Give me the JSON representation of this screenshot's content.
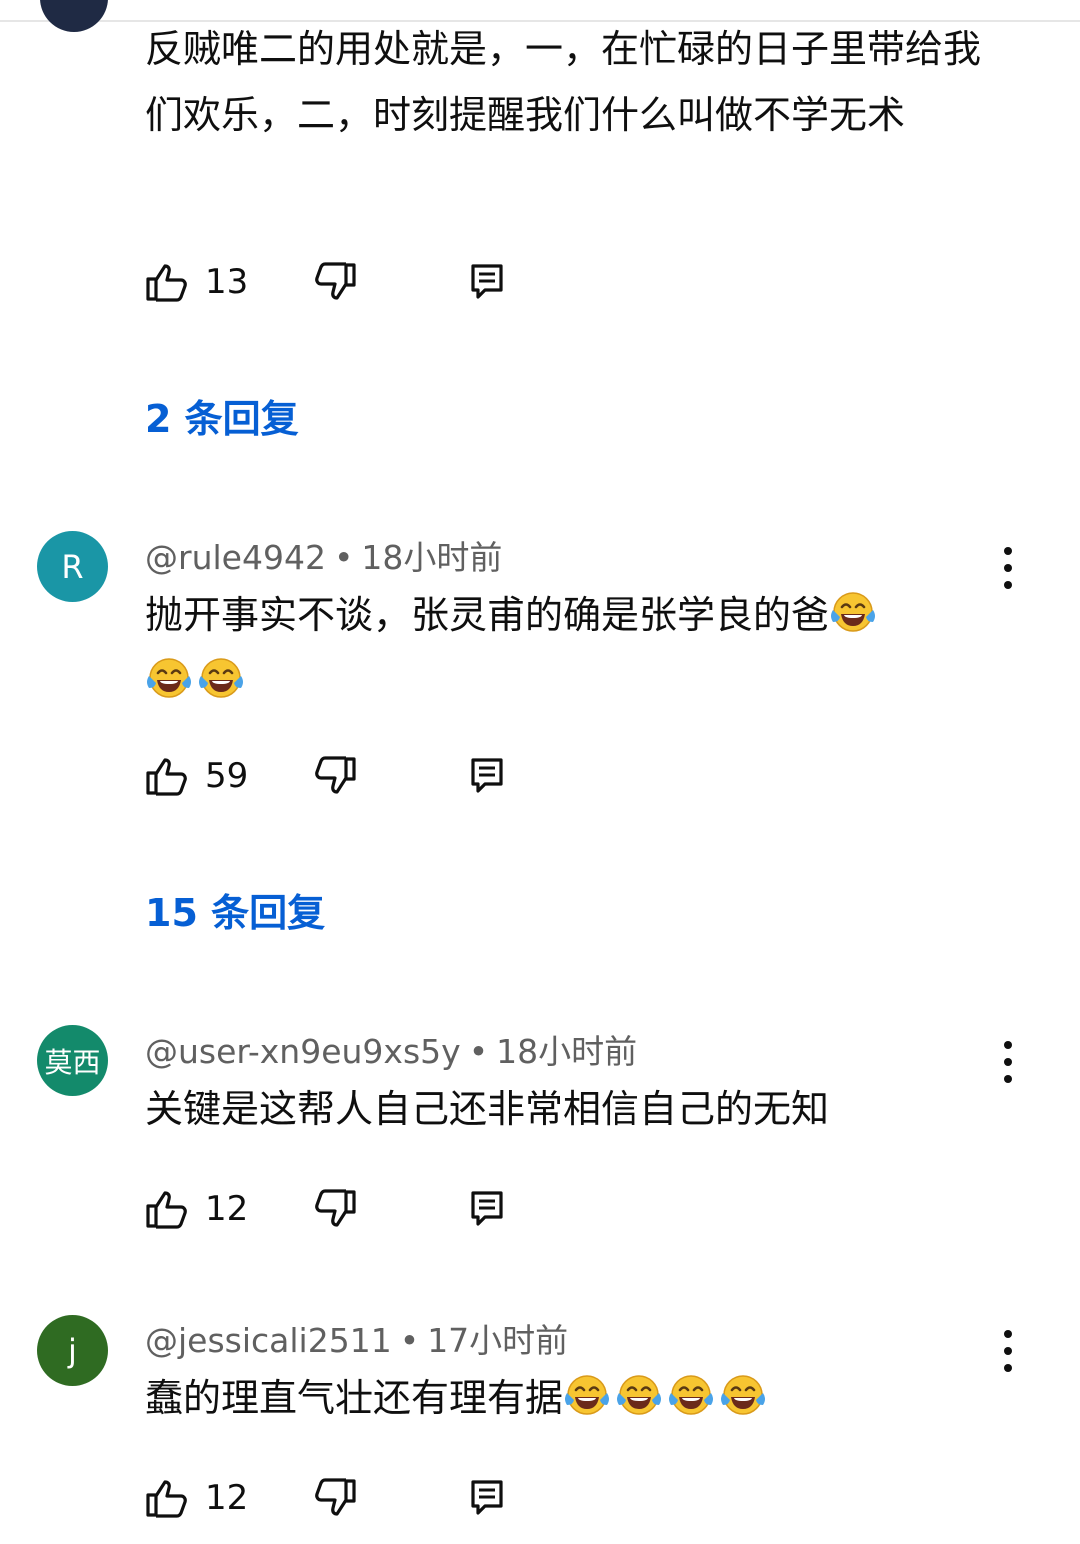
{
  "comments": [
    {
      "author": "",
      "time": "",
      "text": "反贼唯二的用处就是，一，在忙碌的日子里带给我们欢乐，二，时刻提醒我们什么叫做不学无术",
      "likes": "13",
      "replies": "2 条回复"
    },
    {
      "avatar_letter": "R",
      "avatar_color": "#1a96a6",
      "author": "@rule4942",
      "time": "18小时前",
      "text": "抛开事实不谈，张灵甫的确是张学良的爸",
      "emoji": "face-with-tears-of-joy",
      "emoji_count": 3,
      "likes": "59",
      "replies": "15 条回复"
    },
    {
      "avatar_letter": "莫西",
      "avatar_color": "#138a6b",
      "author": "@user-xn9eu9xs5y",
      "time": "18小时前",
      "text": "关键是这帮人自己还非常相信自己的无知",
      "likes": "12"
    },
    {
      "avatar_letter": "j",
      "avatar_color": "#2f6b22",
      "author": "@jessicali2511",
      "time": "17小时前",
      "text": "蠢的理直气壮还有理有据",
      "emoji": "face-with-tears-of-joy",
      "emoji_count": 4,
      "likes": "12"
    }
  ],
  "separator": "•"
}
